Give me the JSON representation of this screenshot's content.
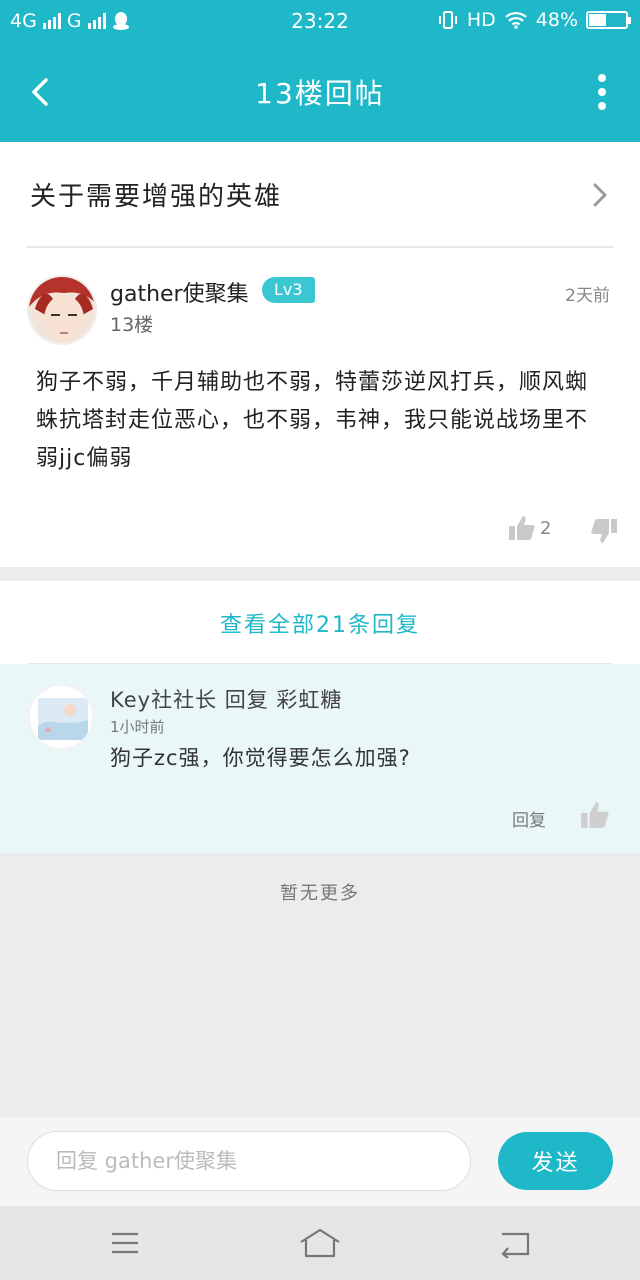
{
  "status_bar": {
    "network_1": "4G",
    "network_2": "G",
    "time": "23:22",
    "hd": "HD",
    "battery": "48%",
    "battery_level": 0.48
  },
  "header": {
    "title": "13楼回帖"
  },
  "topic": {
    "title": "关于需要增强的英雄"
  },
  "post": {
    "username": "gather使聚集",
    "level": "Lv3",
    "floor": "13楼",
    "time": "2天前",
    "content": "狗子不弱，千月辅助也不弱，特蕾莎逆风打兵，顺风蜘蛛抗塔封走位恶心，也不弱，韦神，我只能说战场里不弱jjc偏弱",
    "likes": "2"
  },
  "view_all": {
    "label": "查看全部21条回复"
  },
  "reply": {
    "header": "Key社社长 回复 彩虹糖",
    "time": "1小时前",
    "text": "狗子zc强，你觉得要怎么加强?",
    "reply_label": "回复"
  },
  "footer": {
    "no_more": "暂无更多"
  },
  "input_bar": {
    "placeholder": "回复 gather使聚集",
    "value": "",
    "send_label": "发送"
  },
  "colors": {
    "accent": "#1fb8c9",
    "reply_bg": "#eaf7f8",
    "badge": "#3bc7d2"
  },
  "icons": [
    "back-icon",
    "more-icon",
    "chevron-right-icon",
    "thumbs-up-icon",
    "thumbs-down-icon",
    "menu-icon",
    "home-icon",
    "return-icon"
  ]
}
